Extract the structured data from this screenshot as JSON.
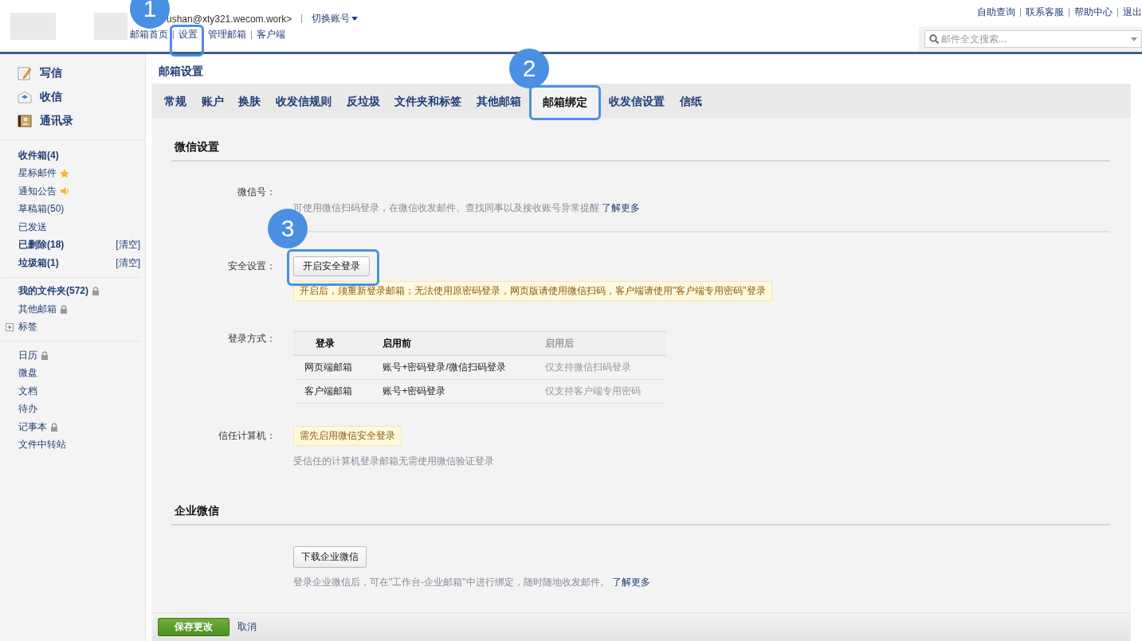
{
  "header": {
    "account": "ushan@xty321.wecom.work>",
    "switch_account": "切换账号",
    "nav_links": [
      "邮箱首页",
      "设置",
      "管理邮箱",
      "客户端"
    ],
    "top_links": [
      "自助查询",
      "联系客服",
      "帮助中心",
      "退出"
    ],
    "search": {
      "placeholder": "邮件全文搜索..."
    }
  },
  "sidebar": {
    "actions": [
      {
        "label": "写信",
        "kind": "compose"
      },
      {
        "label": "收信",
        "kind": "receive"
      },
      {
        "label": "通讯录",
        "kind": "contacts"
      }
    ],
    "groups": [
      {
        "items": [
          {
            "label": "收件箱(4)",
            "bold": true
          },
          {
            "label": "星标邮件",
            "bold": false,
            "kind": "star"
          },
          {
            "label": "通知公告",
            "bold": false,
            "kind": "speaker"
          },
          {
            "label": "草稿箱(50)",
            "bold": false
          },
          {
            "label": "已发送",
            "bold": false
          },
          {
            "label": "已删除(18)",
            "bold": true,
            "action": "[清空]"
          },
          {
            "label": "垃圾箱(1)",
            "bold": true,
            "action": "[清空]"
          }
        ]
      },
      {
        "items": [
          {
            "label": "我的文件夹(572)",
            "bold": true,
            "kind": "lock"
          },
          {
            "label": "其他邮箱",
            "bold": false,
            "kind": "lock"
          },
          {
            "label": "标签",
            "bold": false,
            "expanded": false
          }
        ]
      },
      {
        "items": [
          {
            "label": "日历",
            "bold": false,
            "kind": "lock"
          },
          {
            "label": "微盘",
            "bold": false
          },
          {
            "label": "文档",
            "bold": false
          },
          {
            "label": "待办",
            "bold": false
          },
          {
            "label": "记事本",
            "bold": false,
            "kind": "lock"
          },
          {
            "label": "文件中转站",
            "bold": false
          }
        ]
      }
    ]
  },
  "page_title": "邮箱设置",
  "tabs": [
    {
      "label": "常规",
      "selected": false
    },
    {
      "label": "账户",
      "selected": false
    },
    {
      "label": "换肤",
      "selected": false
    },
    {
      "label": "收发信规则",
      "selected": false
    },
    {
      "label": "反垃圾",
      "selected": false
    },
    {
      "label": "文件夹和标签",
      "selected": false
    },
    {
      "label": "其他邮箱",
      "selected": false
    },
    {
      "label": "邮箱绑定",
      "selected": true
    },
    {
      "label": "收发信设置",
      "selected": false
    },
    {
      "label": "信纸",
      "selected": false
    }
  ],
  "wechat": {
    "title": "微信设置",
    "wechat_id": {
      "label": "微信号：",
      "hint": "可使用微信扫码登录，在微信收发邮件、查找同事以及接收账号异常提醒",
      "link": "了解更多"
    },
    "security": {
      "label": "安全设置：",
      "button": "开启安全登录",
      "notice": "开启后，须重新登录邮箱；无法使用原密码登录，网页版请使用微信扫码，客户端请使用\"客户端专用密码\"登录"
    },
    "login_methods": {
      "label": "登录方式：",
      "columns": [
        "登录",
        "启用前",
        "启用后"
      ],
      "rows": [
        [
          "网页端邮箱",
          "账号+密码登录/微信扫码登录",
          "仅支持微信扫码登录"
        ],
        [
          "客户端邮箱",
          "账号+密码登录",
          "仅支持客户端专用密码"
        ]
      ]
    },
    "trusted": {
      "label": "信任计算机：",
      "notice": "需先启用微信安全登录",
      "hint": "受信任的计算机登录邮箱无需使用微信验证登录"
    }
  },
  "wework": {
    "title": "企业微信",
    "button": "下载企业微信",
    "hint": "登录企业微信后，可在\"工作台-企业邮箱\"中进行绑定，随时随地收发邮件。",
    "link": "了解更多"
  },
  "footer": {
    "save": "保存更改",
    "cancel": "取消"
  },
  "callouts": [
    {
      "number": "1"
    },
    {
      "number": "2"
    },
    {
      "number": "3"
    }
  ]
}
